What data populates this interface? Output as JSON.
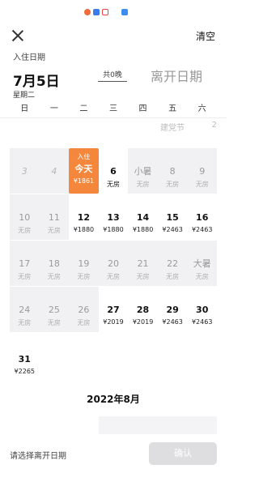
{
  "header": {
    "clear_label": "清空"
  },
  "checkin": {
    "label": "入住日期",
    "date": "7月5日",
    "weekday": "星期二",
    "nights": "共0晚",
    "checkout_placeholder": "离开日期"
  },
  "weekdays": [
    "日",
    "一",
    "二",
    "三",
    "四",
    "五",
    "六"
  ],
  "header_peek": {
    "holiday": "建党节",
    "day": "2"
  },
  "calendar": {
    "rows": [
      [
        {
          "day": "",
          "price": "",
          "state": "empty"
        },
        {
          "day": "",
          "price": "",
          "state": "empty"
        },
        {
          "day": "",
          "price": "",
          "state": "empty"
        },
        {
          "day": "",
          "price": "",
          "state": "empty"
        },
        {
          "day": "",
          "price": "",
          "state": "empty"
        },
        {
          "day": "",
          "price": "",
          "state": "empty"
        },
        {
          "day": "",
          "price": "",
          "state": "empty"
        }
      ],
      [
        {
          "day": "3",
          "price": "",
          "state": "past"
        },
        {
          "day": "4",
          "price": "",
          "state": "past"
        },
        {
          "tag": "入住",
          "day": "今天",
          "price": "¥1861",
          "state": "today"
        },
        {
          "day": "6",
          "price": "无房",
          "state": "plain"
        },
        {
          "day": "小暑",
          "price": "无房",
          "state": "disabled"
        },
        {
          "day": "8",
          "price": "无房",
          "state": "disabled"
        },
        {
          "day": "9",
          "price": "无房",
          "state": "disabled"
        }
      ],
      [
        {
          "day": "10",
          "price": "无房",
          "state": "disabled"
        },
        {
          "day": "11",
          "price": "无房",
          "state": "disabled"
        },
        {
          "day": "12",
          "price": "¥1880",
          "state": "available"
        },
        {
          "day": "13",
          "price": "¥1880",
          "state": "available"
        },
        {
          "day": "14",
          "price": "¥1880",
          "state": "available"
        },
        {
          "day": "15",
          "price": "¥2463",
          "state": "available"
        },
        {
          "day": "16",
          "price": "¥2463",
          "state": "available"
        }
      ],
      [
        {
          "day": "17",
          "price": "无房",
          "state": "disabled"
        },
        {
          "day": "18",
          "price": "无房",
          "state": "disabled"
        },
        {
          "day": "19",
          "price": "无房",
          "state": "disabled"
        },
        {
          "day": "20",
          "price": "无房",
          "state": "disabled"
        },
        {
          "day": "21",
          "price": "无房",
          "state": "disabled"
        },
        {
          "day": "22",
          "price": "无房",
          "state": "disabled"
        },
        {
          "day": "大暑",
          "price": "无房",
          "state": "disabled"
        }
      ],
      [
        {
          "day": "24",
          "price": "无房",
          "state": "disabled"
        },
        {
          "day": "25",
          "price": "无房",
          "state": "disabled"
        },
        {
          "day": "26",
          "price": "无房",
          "state": "disabled"
        },
        {
          "day": "27",
          "price": "¥2019",
          "state": "available"
        },
        {
          "day": "28",
          "price": "¥2019",
          "state": "available"
        },
        {
          "day": "29",
          "price": "¥2463",
          "state": "available"
        },
        {
          "day": "30",
          "price": "¥2463",
          "state": "available"
        }
      ],
      [
        {
          "day": "31",
          "price": "¥2265",
          "state": "available"
        }
      ]
    ],
    "next_month_title": "2022年8月"
  },
  "footer": {
    "hint": "请选择离开日期",
    "confirm_label": "确认"
  }
}
